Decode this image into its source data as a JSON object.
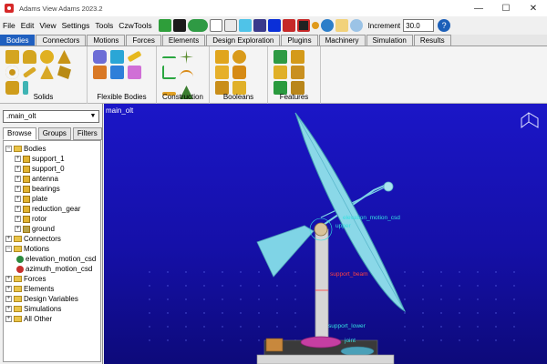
{
  "window": {
    "title": "Adams View Adams 2023.2",
    "min_glyph": "—",
    "max_glyph": "☐",
    "close_glyph": "✕"
  },
  "menu": [
    "File",
    "Edit",
    "View",
    "Settings",
    "Tools",
    "CzwTools"
  ],
  "toolbar": {
    "icons": [
      "new-file-icon",
      "save-icon",
      "undo-icon",
      "select-arrow-icon",
      "page-icon",
      "cube-icon",
      "grid-icon",
      "render-icon",
      "camera-icon",
      "fit-icon",
      "rotate-icon",
      "pan-icon",
      "zoom-icon"
    ],
    "increment_label": "Increment",
    "increment_value": "30.0",
    "help_glyph": "?"
  },
  "ribbon": {
    "tabs": [
      "Bodies",
      "Connectors",
      "Motions",
      "Forces",
      "Elements",
      "Design Exploration",
      "Plugins",
      "Machinery",
      "Simulation",
      "Results"
    ],
    "active_tab": "Bodies",
    "groups": [
      {
        "label": "Solids",
        "icon_count": 10
      },
      {
        "label": "Flexible Bodies",
        "icon_count": 6
      },
      {
        "label": "Construction",
        "icon_count": 8
      },
      {
        "label": "Booleans",
        "icon_count": 6
      },
      {
        "label": "Features",
        "icon_count": 6
      }
    ],
    "colors": {
      "tab_active": "#1f5fbf",
      "solid_icon": "#e1b331"
    }
  },
  "left_panel": {
    "model": ".main_olt",
    "tabs": [
      "Browse",
      "Groups",
      "Filters"
    ],
    "active_tab": "Browse",
    "tree": {
      "bodies": {
        "label": "Bodies",
        "children": [
          "support_1",
          "support_0",
          "antenna",
          "bearings",
          "plate",
          "reduction_gear",
          "rotor",
          "ground"
        ]
      },
      "connectors": {
        "label": "Connectors"
      },
      "motions": {
        "label": "Motions",
        "children": [
          "elevation_motion_csd",
          "azimuth_motion_csd"
        ]
      },
      "forces": {
        "label": "Forces"
      },
      "elements": {
        "label": "Elements"
      },
      "design_variables": {
        "label": "Design Variables"
      },
      "simulations": {
        "label": "Simulations"
      },
      "all_other": {
        "label": "All Other"
      }
    }
  },
  "viewport": {
    "model_label": "main_olt",
    "annotations": {
      "elevation": "elevation_motion_csd",
      "upper": "upper",
      "support_beam": "support_beam",
      "support_lower": "support_lower",
      "joint": "joint"
    },
    "colors": {
      "background": "#1b16c7",
      "dish": "#7fd4e6",
      "annotation": "#35e0e0",
      "annotation_red": "#ff4040"
    }
  }
}
